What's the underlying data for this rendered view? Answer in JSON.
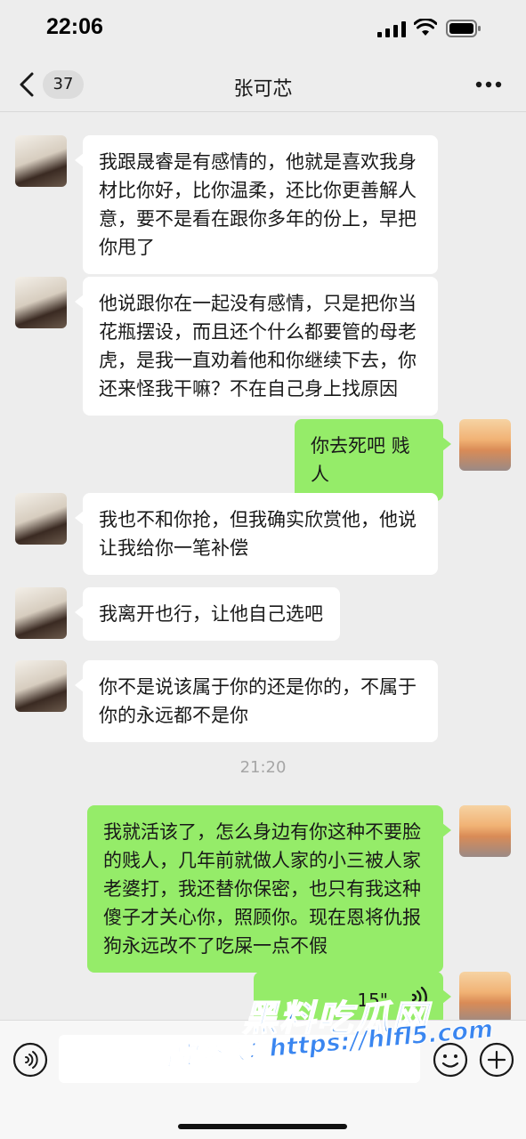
{
  "status_bar": {
    "time": "22:06"
  },
  "nav": {
    "back_count": "37",
    "title": "张可芯"
  },
  "messages": [
    {
      "side": "left",
      "text": "我跟晟睿是有感情的，他就是喜欢我身材比你好，比你温柔，还比你更善解人意，要不是看在跟你多年的份上，早把你甩了"
    },
    {
      "side": "left",
      "text": "他说跟你在一起没有感情，只是把你当花瓶摆设，而且还个什么都要管的母老虎，是我一直劝着他和你继续下去，你还来怪我干嘛？不在自己身上找原因"
    },
    {
      "side": "right",
      "text": "你去死吧 贱人"
    },
    {
      "side": "left",
      "text": "我也不和你抢，但我确实欣赏他，他说让我给你一笔补偿"
    },
    {
      "side": "left",
      "text": "我离开也行，让他自己选吧"
    },
    {
      "side": "left",
      "text": "你不是说该属于你的还是你的，不属于你的永远都不是你"
    },
    {
      "side": "right",
      "text": "我就活该了，怎么身边有你这种不要脸的贱人，几年前就做人家的小三被人家老婆打，我还替你保密，也只有我这种傻子才关心你，照顾你。现在恩将仇报狗永远改不了吃屎一点不假"
    },
    {
      "side": "right",
      "type": "voice",
      "duration": "15\""
    }
  ],
  "timestamp": "21:20",
  "watermark": {
    "title": "黑料吃瓜网",
    "url": "看完整版：https://hlfl5.com"
  },
  "colors": {
    "background": "#ededed",
    "bubble_self": "#95ec69",
    "bubble_other": "#ffffff"
  }
}
